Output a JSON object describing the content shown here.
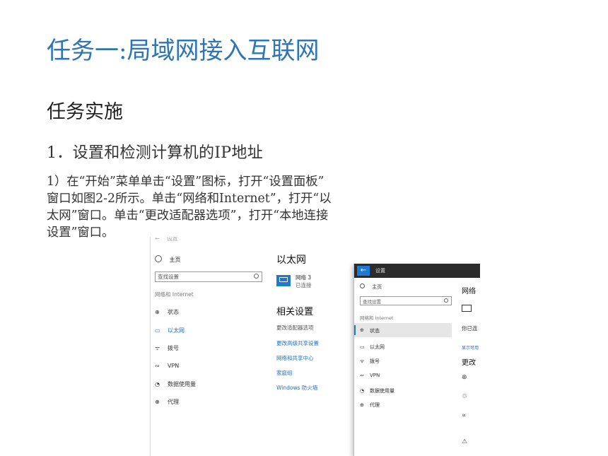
{
  "title": "任务一:局域网接入互联网",
  "subtitle": "任务实施",
  "step": "1．设置和检测计算机的IP地址",
  "paragraph": [
    "1）在“开始”菜单单击“设置”图标，打开“设置面板”",
    "窗口如图2-2所示。单击“网络和Internet”，打开“以",
    "太网”窗口。单击“更改适配器选项”，打开“本地连接",
    "设置”窗口。"
  ],
  "screenshot": {
    "top_label": "设置",
    "home": "主页",
    "search_placeholder": "查找设置",
    "category": "网络和 Internet",
    "nav": [
      "状态",
      "以太网",
      "拨号",
      "VPN",
      "数据使用量",
      "代理"
    ],
    "main_title": "以太网",
    "network_name": "网络 3",
    "network_status": "已连接",
    "related_title": "相关设置",
    "related_links": [
      "更改适配器选项",
      "更改高级共享设置",
      "网络和共享中心",
      "家庭组",
      "Windows 防火墙"
    ],
    "overlay": {
      "title": "设置",
      "home": "主页",
      "search_placeholder": "查找设置",
      "category": "网络和 Internet",
      "nav": [
        "状态",
        "以太网",
        "拨号",
        "VPN",
        "数据使用量",
        "代理"
      ],
      "right_heading": "网络",
      "right_status": "你已连",
      "right_link": "显示可用",
      "right_heading2": "更改"
    }
  }
}
